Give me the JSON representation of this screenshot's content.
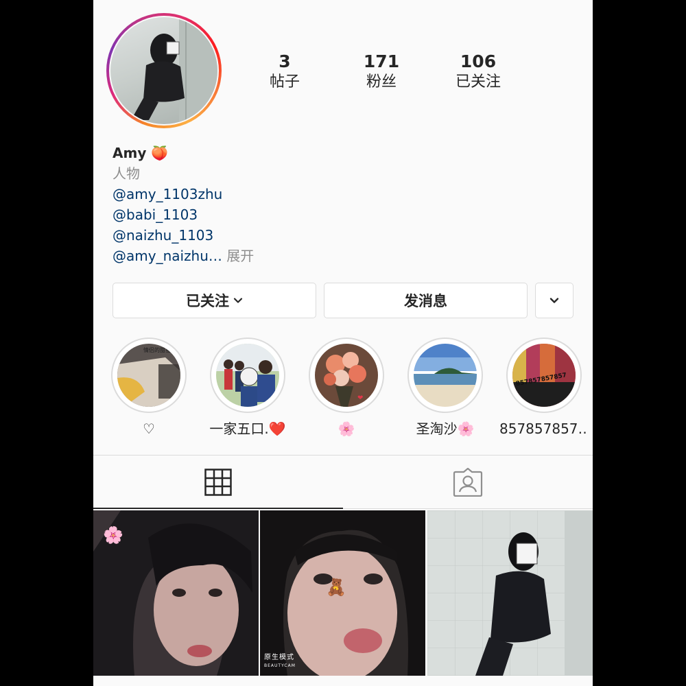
{
  "profile": {
    "stats": [
      {
        "value": "3",
        "label": "帖子"
      },
      {
        "value": "171",
        "label": "粉丝"
      },
      {
        "value": "106",
        "label": "已关注"
      }
    ],
    "name": "Amy 🍑",
    "category": "人物",
    "links": [
      "@amy_1103zhu",
      "@babi_1103",
      "@naizhu_1103"
    ],
    "last_link": "@amy_naizhu…",
    "more_label": "展开"
  },
  "buttons": {
    "following_label": "已关注",
    "message_label": "发消息"
  },
  "highlights": [
    {
      "label": "♡"
    },
    {
      "label": "一家五口.❤️"
    },
    {
      "label": "🌸"
    },
    {
      "label": "圣淘沙🌸"
    },
    {
      "label": "857857857…"
    }
  ],
  "highlight_overlays": {
    "first": "情侣的甜蜜",
    "last": "857857857857"
  },
  "posts": {
    "watermark_line1": "原生模式",
    "watermark_line2": "BEAUTYCAM"
  },
  "colors": {
    "link": "#003569",
    "muted": "#8e8e8e",
    "border": "#dbdbdb",
    "background": "#fafafa"
  },
  "icons": [
    "grid-icon",
    "tagged-icon",
    "chevron-down-icon"
  ]
}
